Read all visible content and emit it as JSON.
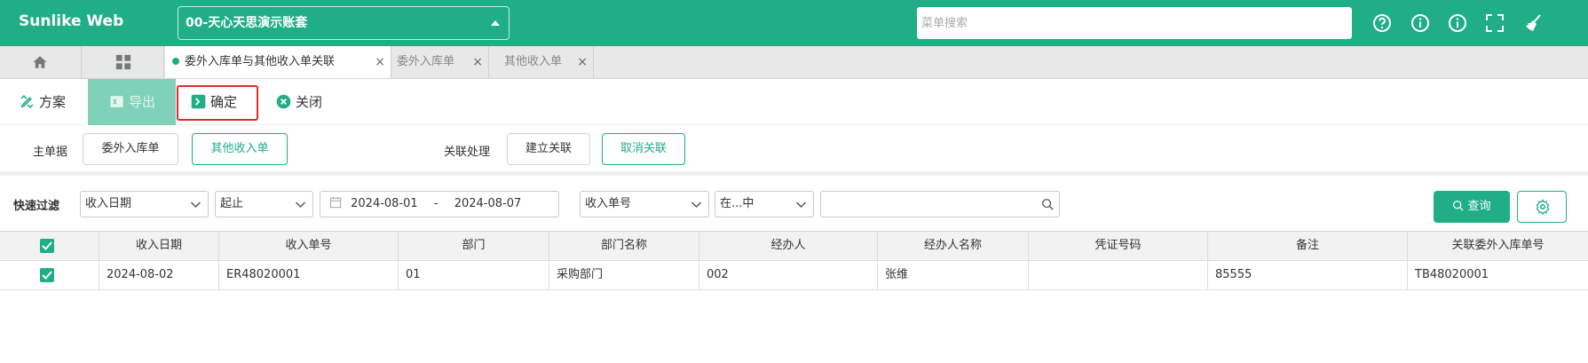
{
  "app": {
    "brand": "Sunlike Web",
    "account": "00-天心天思演示账套",
    "menu_search_placeholder": "菜单搜索"
  },
  "top_icons": [
    "help-icon",
    "info-icon",
    "info-icon",
    "fullscreen-icon",
    "broom-icon"
  ],
  "tabs": [
    {
      "label": "委外入库单与其他收入单关联",
      "active": true
    },
    {
      "label": "委外入库单",
      "active": false
    },
    {
      "label": "其他收入单",
      "active": false
    }
  ],
  "toolbar": {
    "scheme": "方案",
    "export": "导出",
    "confirm": "确定",
    "close": "关闭"
  },
  "relation": {
    "main_label": "主单据",
    "main_options": [
      "委外入库单",
      "其他收入单"
    ],
    "process_label": "关联处理",
    "build": "建立关联",
    "cancel": "取消关联"
  },
  "filter": {
    "label": "快速过滤",
    "field": "收入日期",
    "range_type": "起止",
    "date_from": "2024-08-01",
    "date_sep": "-",
    "date_to": "2024-08-07",
    "field2": "收入单号",
    "op": "在...中",
    "value": "",
    "query": "查询"
  },
  "colors": {
    "brand": "#1fae86",
    "highlight_border": "#e5282e"
  },
  "table": {
    "columns": [
      "收入日期",
      "收入单号",
      "部门",
      "部门名称",
      "经办人",
      "经办人名称",
      "凭证号码",
      "备注",
      "关联委外入库单号"
    ],
    "rows": [
      {
        "checked": true,
        "cells": [
          "2024-08-02",
          "ER48020001",
          "01",
          "采购部门",
          "002",
          "张维",
          "",
          "85555",
          "TB48020001"
        ]
      }
    ]
  }
}
